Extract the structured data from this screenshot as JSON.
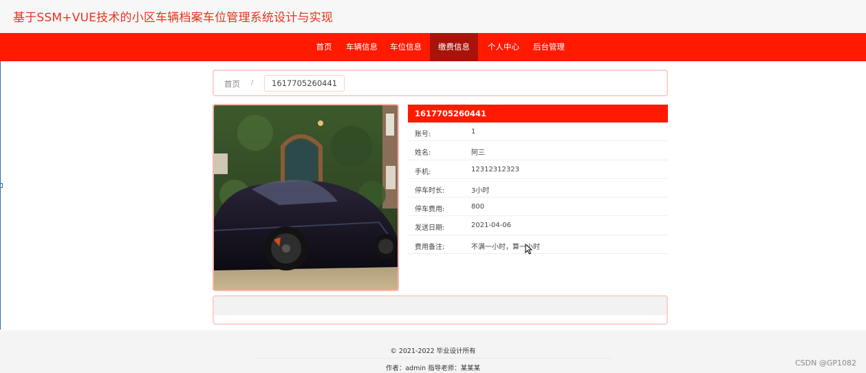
{
  "header": {
    "title": "基于SSM+VUE技术的小区车辆档案车位管理系统设计与实现"
  },
  "nav": {
    "items": [
      {
        "label": "首页"
      },
      {
        "label": "车辆信息"
      },
      {
        "label": "车位信息"
      },
      {
        "label": "缴费信息",
        "active": true
      },
      {
        "label": "个人中心"
      },
      {
        "label": "后台管理"
      }
    ],
    "color": "#ff1a00",
    "active_color": "#a8130a"
  },
  "breadcrumb": {
    "home": "首页",
    "separator": "/",
    "current": "1617705260441"
  },
  "detail": {
    "title": "1617705260441",
    "fields": [
      {
        "label": "账号:",
        "value": "1"
      },
      {
        "label": "姓名:",
        "value": "阿三"
      },
      {
        "label": "手机:",
        "value": "12312312323"
      },
      {
        "label": "停车时长:",
        "value": "3小时"
      },
      {
        "label": "停车费用:",
        "value": "800"
      },
      {
        "label": "发送日期:",
        "value": "2021-04-06"
      },
      {
        "label": "费用备注:",
        "value": "不满一小时，算一小时"
      }
    ]
  },
  "footer": {
    "copyright": "© 2021-2022 毕业设计所有",
    "author": "作者：admin 指导老师：某某某"
  },
  "watermark": "CSDN @GP1082"
}
